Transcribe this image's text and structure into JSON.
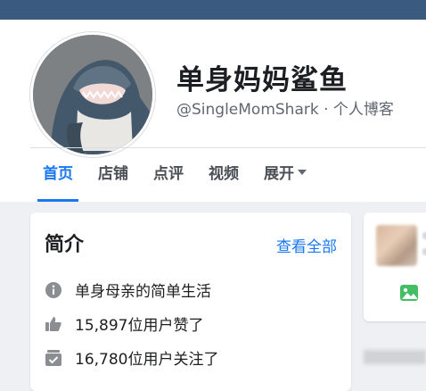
{
  "page": {
    "name": "单身妈妈鲨鱼",
    "handle_line": "@SingleMomShark · 个人博客"
  },
  "tabs": [
    {
      "label": "首页"
    },
    {
      "label": "店铺"
    },
    {
      "label": "点评"
    },
    {
      "label": "视频"
    },
    {
      "label": "展开"
    }
  ],
  "intro": {
    "title": "简介",
    "see_all": "查看全部",
    "rows": [
      {
        "icon": "info-icon",
        "text": "单身母亲的简单生活"
      },
      {
        "icon": "thumbs-up-icon",
        "text": "15,897位用户赞了"
      },
      {
        "icon": "follow-check-icon",
        "text": "16,780位用户关注了"
      }
    ]
  },
  "colors": {
    "accent": "#1877f2",
    "topbar": "#3b5a80"
  }
}
